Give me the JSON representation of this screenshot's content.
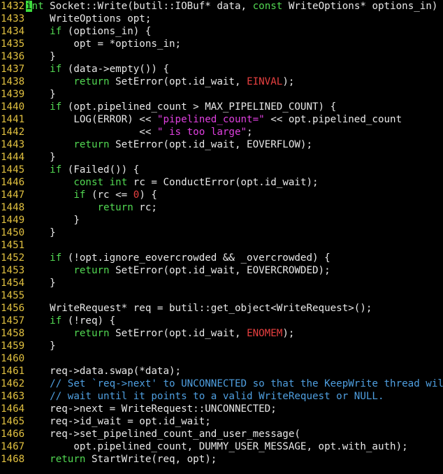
{
  "colors": {
    "background": "#000000",
    "line_number": "#e0c040",
    "plain": "#e8e8e8",
    "keyword": "#52d852",
    "string": "#e040e0",
    "comment": "#4f9fe0",
    "number_const": "#e84040",
    "cursor": "#3cdc3c"
  },
  "lines": [
    {
      "num": "1432",
      "tokens": [
        [
          "cursor",
          "i"
        ],
        [
          "kw",
          "nt"
        ],
        [
          "pl",
          " Socket::Write(butil::IOBuf* data, "
        ],
        [
          "kw",
          "const"
        ],
        [
          "pl",
          " WriteOptions* options_in) {"
        ]
      ]
    },
    {
      "num": "1433",
      "tokens": [
        [
          "pl",
          "    WriteOptions opt;"
        ]
      ]
    },
    {
      "num": "1434",
      "tokens": [
        [
          "pl",
          "    "
        ],
        [
          "kw",
          "if"
        ],
        [
          "pl",
          " (options_in) {"
        ]
      ]
    },
    {
      "num": "1435",
      "tokens": [
        [
          "pl",
          "        opt = *options_in;"
        ]
      ]
    },
    {
      "num": "1436",
      "tokens": [
        [
          "pl",
          "    }"
        ]
      ]
    },
    {
      "num": "1437",
      "tokens": [
        [
          "pl",
          "    "
        ],
        [
          "kw",
          "if"
        ],
        [
          "pl",
          " (data->empty()) {"
        ]
      ]
    },
    {
      "num": "1438",
      "tokens": [
        [
          "pl",
          "        "
        ],
        [
          "kw",
          "return"
        ],
        [
          "pl",
          " SetError(opt.id_wait, "
        ],
        [
          "num",
          "EINVAL"
        ],
        [
          "pl",
          ");"
        ]
      ]
    },
    {
      "num": "1439",
      "tokens": [
        [
          "pl",
          "    }"
        ]
      ]
    },
    {
      "num": "1440",
      "tokens": [
        [
          "pl",
          "    "
        ],
        [
          "kw",
          "if"
        ],
        [
          "pl",
          " (opt.pipelined_count > MAX_PIPELINED_COUNT) {"
        ]
      ]
    },
    {
      "num": "1441",
      "tokens": [
        [
          "pl",
          "        LOG(ERROR) << "
        ],
        [
          "str",
          "\"pipelined_count=\""
        ],
        [
          "pl",
          " << opt.pipelined_count"
        ]
      ]
    },
    {
      "num": "1442",
      "tokens": [
        [
          "pl",
          "                   << "
        ],
        [
          "str",
          "\" is too large\""
        ],
        [
          "pl",
          ";"
        ]
      ]
    },
    {
      "num": "1443",
      "tokens": [
        [
          "pl",
          "        "
        ],
        [
          "kw",
          "return"
        ],
        [
          "pl",
          " SetError(opt.id_wait, EOVERFLOW);"
        ]
      ]
    },
    {
      "num": "1444",
      "tokens": [
        [
          "pl",
          "    }"
        ]
      ]
    },
    {
      "num": "1445",
      "tokens": [
        [
          "pl",
          "    "
        ],
        [
          "kw",
          "if"
        ],
        [
          "pl",
          " (Failed()) {"
        ]
      ]
    },
    {
      "num": "1446",
      "tokens": [
        [
          "pl",
          "        "
        ],
        [
          "kw",
          "const"
        ],
        [
          "pl",
          " "
        ],
        [
          "kw",
          "int"
        ],
        [
          "pl",
          " rc = ConductError(opt.id_wait);"
        ]
      ]
    },
    {
      "num": "1447",
      "tokens": [
        [
          "pl",
          "        "
        ],
        [
          "kw",
          "if"
        ],
        [
          "pl",
          " (rc <= "
        ],
        [
          "num",
          "0"
        ],
        [
          "pl",
          ") {"
        ]
      ]
    },
    {
      "num": "1448",
      "tokens": [
        [
          "pl",
          "            "
        ],
        [
          "kw",
          "return"
        ],
        [
          "pl",
          " rc;"
        ]
      ]
    },
    {
      "num": "1449",
      "tokens": [
        [
          "pl",
          "        }"
        ]
      ]
    },
    {
      "num": "1450",
      "tokens": [
        [
          "pl",
          "    }"
        ]
      ]
    },
    {
      "num": "1451",
      "tokens": [
        [
          "pl",
          ""
        ]
      ]
    },
    {
      "num": "1452",
      "tokens": [
        [
          "pl",
          "    "
        ],
        [
          "kw",
          "if"
        ],
        [
          "pl",
          " (!opt.ignore_eovercrowded && _overcrowded) {"
        ]
      ]
    },
    {
      "num": "1453",
      "tokens": [
        [
          "pl",
          "        "
        ],
        [
          "kw",
          "return"
        ],
        [
          "pl",
          " SetError(opt.id_wait, EOVERCROWDED);"
        ]
      ]
    },
    {
      "num": "1454",
      "tokens": [
        [
          "pl",
          "    }"
        ]
      ]
    },
    {
      "num": "1455",
      "tokens": [
        [
          "pl",
          ""
        ]
      ]
    },
    {
      "num": "1456",
      "tokens": [
        [
          "pl",
          "    WriteRequest* req = butil::get_object<WriteRequest>();"
        ]
      ]
    },
    {
      "num": "1457",
      "tokens": [
        [
          "pl",
          "    "
        ],
        [
          "kw",
          "if"
        ],
        [
          "pl",
          " (!req) {"
        ]
      ]
    },
    {
      "num": "1458",
      "tokens": [
        [
          "pl",
          "        "
        ],
        [
          "kw",
          "return"
        ],
        [
          "pl",
          " SetError(opt.id_wait, "
        ],
        [
          "num",
          "ENOMEM"
        ],
        [
          "pl",
          ");"
        ]
      ]
    },
    {
      "num": "1459",
      "tokens": [
        [
          "pl",
          "    }"
        ]
      ]
    },
    {
      "num": "1460",
      "tokens": [
        [
          "pl",
          ""
        ]
      ]
    },
    {
      "num": "1461",
      "tokens": [
        [
          "pl",
          "    req->data.swap(*data);"
        ]
      ]
    },
    {
      "num": "1462",
      "tokens": [
        [
          "pl",
          "    "
        ],
        [
          "cmt",
          "// Set `req->next' to UNCONNECTED so that the KeepWrite thread will"
        ]
      ]
    },
    {
      "num": "1463",
      "tokens": [
        [
          "pl",
          "    "
        ],
        [
          "cmt",
          "// wait until it points to a valid WriteRequest or NULL."
        ]
      ]
    },
    {
      "num": "1464",
      "tokens": [
        [
          "pl",
          "    req->next = WriteRequest::UNCONNECTED;"
        ]
      ]
    },
    {
      "num": "1465",
      "tokens": [
        [
          "pl",
          "    req->id_wait = opt.id_wait;"
        ]
      ]
    },
    {
      "num": "1466",
      "tokens": [
        [
          "pl",
          "    req->set_pipelined_count_and_user_message("
        ]
      ]
    },
    {
      "num": "1467",
      "tokens": [
        [
          "pl",
          "        opt.pipelined_count, DUMMY_USER_MESSAGE, opt.with_auth);"
        ]
      ]
    },
    {
      "num": "1468",
      "tokens": [
        [
          "pl",
          "    "
        ],
        [
          "kw",
          "return"
        ],
        [
          "pl",
          " StartWrite(req, opt);"
        ]
      ]
    }
  ]
}
